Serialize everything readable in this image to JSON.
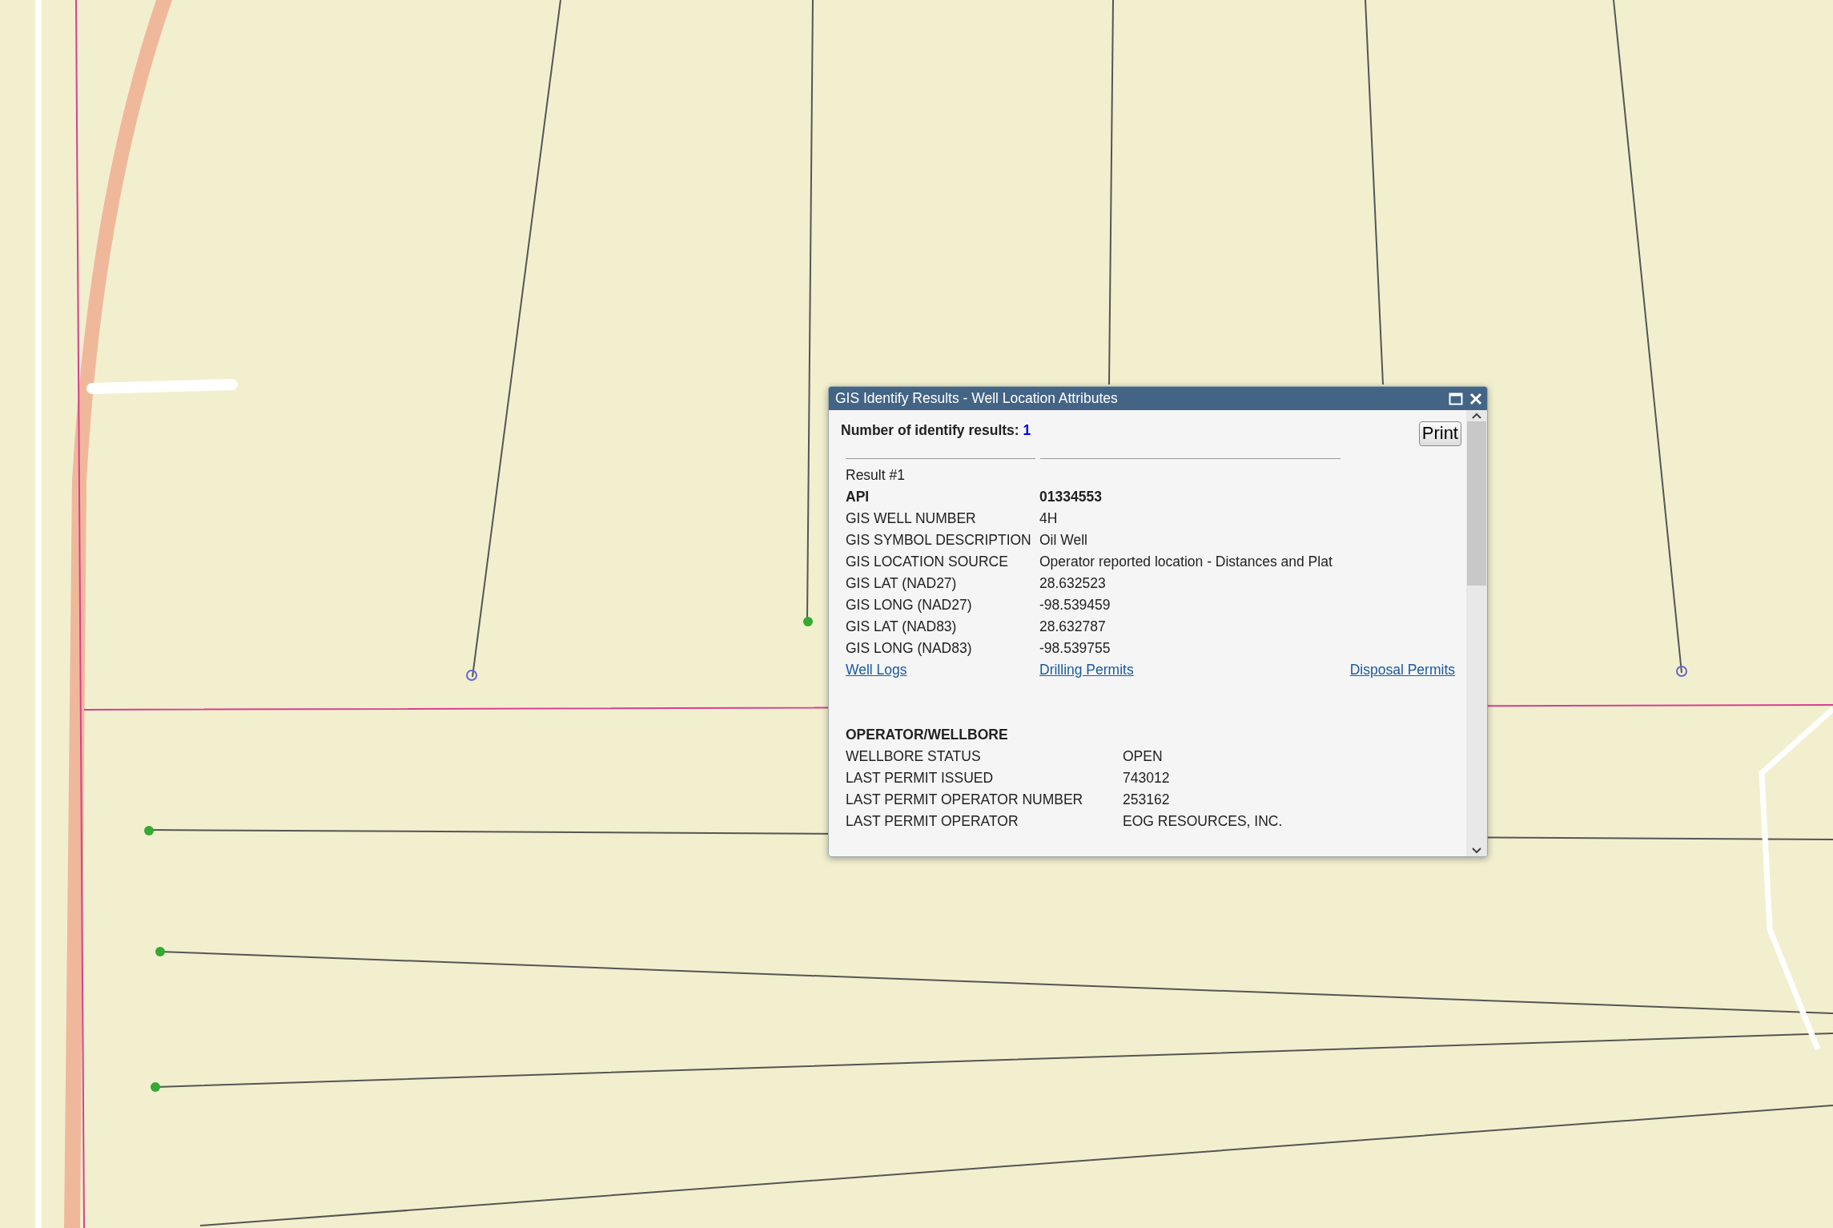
{
  "map": {
    "kind": "picture"
  },
  "window": {
    "title": "GIS Identify Results - Well Location Attributes"
  },
  "summary": {
    "label": "Number of identify results:",
    "count": "1"
  },
  "print_button": "Print",
  "result": {
    "heading": "Result #1",
    "rows": [
      {
        "label": "API",
        "value": "01334553",
        "bold": true
      },
      {
        "label": "GIS WELL NUMBER",
        "value": "4H",
        "bold": false
      },
      {
        "label": "GIS SYMBOL DESCRIPTION",
        "value": "Oil Well",
        "bold": false
      },
      {
        "label": "GIS LOCATION SOURCE",
        "value": "Operator reported location - Distances and Plat",
        "bold": false
      },
      {
        "label": "GIS LAT (NAD27)",
        "value": "28.632523",
        "bold": false
      },
      {
        "label": "GIS LONG (NAD27)",
        "value": "-98.539459",
        "bold": false
      },
      {
        "label": "GIS LAT (NAD83)",
        "value": "28.632787",
        "bold": false
      },
      {
        "label": "GIS LONG (NAD83)",
        "value": "-98.539755",
        "bold": false
      }
    ]
  },
  "links": [
    "Well Logs",
    "Drilling Permits",
    "Disposal Permits"
  ],
  "operator": {
    "heading": "OPERATOR/WELLBORE",
    "rows": [
      {
        "label": "WELLBORE STATUS",
        "value": "OPEN"
      },
      {
        "label": "LAST PERMIT ISSUED",
        "value": "743012"
      },
      {
        "label": "LAST PERMIT OPERATOR NUMBER",
        "value": "253162"
      },
      {
        "label": "LAST PERMIT OPERATOR",
        "value": "EOG RESOURCES, INC."
      }
    ]
  }
}
